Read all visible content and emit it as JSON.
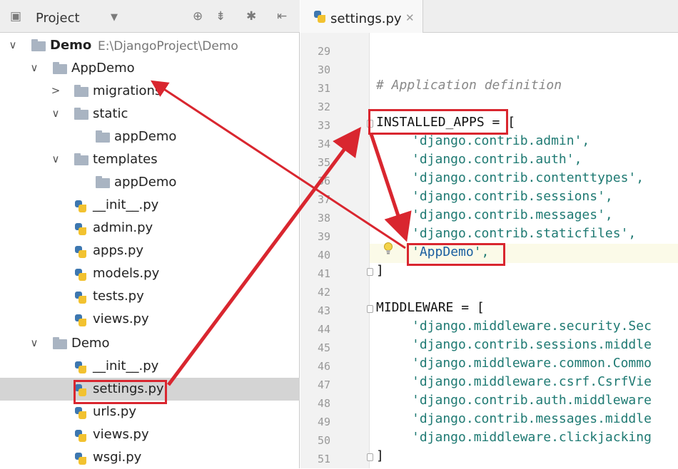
{
  "project_panel": {
    "title": "Project",
    "tree": [
      {
        "label": "Demo",
        "path": "E:\\DjangoProject\\Demo"
      },
      {
        "label": "AppDemo"
      },
      {
        "label": "migrations"
      },
      {
        "label": "static"
      },
      {
        "label": "appDemo"
      },
      {
        "label": "templates"
      },
      {
        "label": "appDemo"
      },
      {
        "label": "__init__.py"
      },
      {
        "label": "admin.py"
      },
      {
        "label": "apps.py"
      },
      {
        "label": "models.py"
      },
      {
        "label": "tests.py"
      },
      {
        "label": "views.py"
      },
      {
        "label": "Demo"
      },
      {
        "label": "__init__.py"
      },
      {
        "label": "settings.py"
      },
      {
        "label": "urls.py"
      },
      {
        "label": "views.py"
      },
      {
        "label": "wsgi.py"
      }
    ]
  },
  "editor": {
    "tab_label": "settings.py",
    "line_numbers": [
      "29",
      "30",
      "31",
      "32",
      "33",
      "34",
      "35",
      "36",
      "37",
      "38",
      "39",
      "40",
      "41",
      "42",
      "43",
      "44",
      "45",
      "46",
      "47",
      "48",
      "49",
      "50",
      "51"
    ],
    "lines": {
      "l31": "# Application definition",
      "l33_name": "INSTALLED_APPS",
      "l33_rest": " = [",
      "l34": "'django.contrib.admin',",
      "l35": "'django.contrib.auth',",
      "l36": "'django.contrib.contenttypes',",
      "l37": "'django.contrib.sessions',",
      "l38": "'django.contrib.messages',",
      "l39": "'django.contrib.staticfiles',",
      "l40_q1": "'",
      "l40_name": "AppDemo",
      "l40_q2": "',",
      "l41": "]",
      "l43": "MIDDLEWARE = [",
      "l44": "'django.middleware.security.Sec",
      "l45": "'django.contrib.sessions.middle",
      "l46": "'django.middleware.common.Commo",
      "l47": "'django.middleware.csrf.CsrfVie",
      "l48": "'django.contrib.auth.middleware",
      "l49": "'django.contrib.messages.middle",
      "l50": "'django.middleware.clickjacking",
      "l51": "]"
    }
  },
  "colors": {
    "annotation": "#d9262f",
    "string": "#1f7a73",
    "comment": "#888888"
  }
}
